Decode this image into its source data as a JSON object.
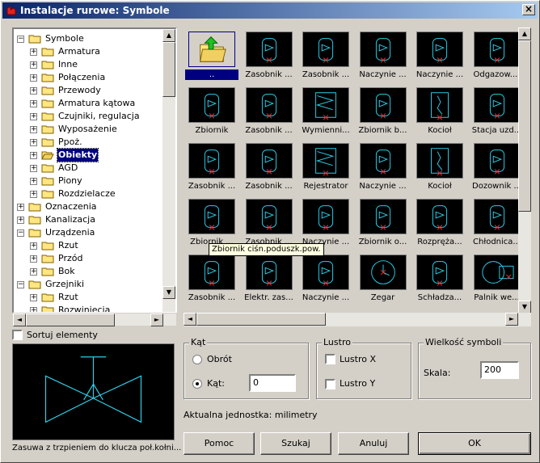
{
  "window": {
    "title": "Instalacje rurowe: Symbole"
  },
  "tree": {
    "items": [
      {
        "label": "Symbole",
        "level": 0,
        "expanded": true
      },
      {
        "label": "Armatura",
        "level": 1
      },
      {
        "label": "Inne",
        "level": 1
      },
      {
        "label": "Połączenia",
        "level": 1
      },
      {
        "label": "Przewody",
        "level": 1
      },
      {
        "label": "Armatura kątowa",
        "level": 1
      },
      {
        "label": "Czujniki, regulacja",
        "level": 1
      },
      {
        "label": "Wyposażenie",
        "level": 1
      },
      {
        "label": "Ppoż.",
        "level": 1
      },
      {
        "label": "Obiekty",
        "level": 1,
        "selected": true
      },
      {
        "label": "AGD",
        "level": 1
      },
      {
        "label": "Piony",
        "level": 1
      },
      {
        "label": "Rozdzielacze",
        "level": 1
      },
      {
        "label": "Oznaczenia",
        "level": 0
      },
      {
        "label": "Kanalizacja",
        "level": 0
      },
      {
        "label": "Urządzenia",
        "level": 0,
        "expanded": true
      },
      {
        "label": "Rzut",
        "level": 1
      },
      {
        "label": "Przód",
        "level": 1
      },
      {
        "label": "Bok",
        "level": 1
      },
      {
        "label": "Grzejniki",
        "level": 0,
        "expanded": true
      },
      {
        "label": "Rzut",
        "level": 1
      },
      {
        "label": "Rozwinięcia",
        "level": 1
      }
    ]
  },
  "symbols": [
    {
      "label": "..",
      "icon": "folder-up-icon"
    },
    {
      "label": "Zasobnik ...",
      "icon": "tank-icon"
    },
    {
      "label": "Zasobnik ...",
      "icon": "tank-icon"
    },
    {
      "label": "Naczynie ...",
      "icon": "tank-icon"
    },
    {
      "label": "Naczynie ...",
      "icon": "tank-icon"
    },
    {
      "label": "Odgazow....",
      "icon": "tank-icon"
    },
    {
      "label": "Zbiornik",
      "icon": "tank-icon"
    },
    {
      "label": "Zasobnik ...",
      "icon": "tank-icon"
    },
    {
      "label": "Wymienni...",
      "icon": "heat-exchanger-icon"
    },
    {
      "label": "Zbiornik b...",
      "icon": "tank-icon"
    },
    {
      "label": "Kocioł",
      "icon": "boiler-icon"
    },
    {
      "label": "Stacja uzd...",
      "icon": "tank-icon"
    },
    {
      "label": "Zasobnik ...",
      "icon": "tank-icon"
    },
    {
      "label": "Zasobnik ...",
      "icon": "tank-icon"
    },
    {
      "label": "Rejestrator",
      "icon": "heat-exchanger-icon"
    },
    {
      "label": "Naczynie ...",
      "icon": "tank-icon"
    },
    {
      "label": "Kocioł",
      "icon": "boiler-icon"
    },
    {
      "label": "Dozownik ...",
      "icon": "tank-icon"
    },
    {
      "label": "Zbiornik ...",
      "icon": "tank-icon"
    },
    {
      "label": "Zasobnik ...",
      "icon": "tank-icon"
    },
    {
      "label": "Naczynie ...",
      "icon": "tank-icon"
    },
    {
      "label": "Zbiornik o...",
      "icon": "tank-icon"
    },
    {
      "label": "Rozpręża...",
      "icon": "tank-icon"
    },
    {
      "label": "Chłodnica...",
      "icon": "tank-icon"
    },
    {
      "label": "Zasobnik ...",
      "icon": "tank-icon"
    },
    {
      "label": "Elektr. zas...",
      "icon": "tank-icon"
    },
    {
      "label": "Naczynie ...",
      "icon": "tank-icon"
    },
    {
      "label": "Zegar",
      "icon": "clock-icon"
    },
    {
      "label": "Schładza...",
      "icon": "tank-icon"
    },
    {
      "label": "Palnik we...",
      "icon": "burner-icon"
    }
  ],
  "tooltip": "Zbiornik ciśn.poduszk.pow.",
  "sort": {
    "label": "Sortuj elementy",
    "checked": false
  },
  "preview": {
    "caption": "Zasuwa z trzpieniem do klucza poł.kołni..."
  },
  "angle": {
    "legend": "Kąt",
    "rotate_label": "Obrót",
    "angle_label": "Kąt:",
    "value": "0"
  },
  "mirror": {
    "legend": "Lustro",
    "x_label": "Lustro X",
    "y_label": "Lustro Y"
  },
  "size": {
    "legend": "Wielkość symboli",
    "scale_label": "Skala:",
    "value": "200"
  },
  "unit_text": "Aktualna jednostka: milimetry",
  "buttons": {
    "help": "Pomoc",
    "search": "Szukaj",
    "cancel": "Anuluj",
    "ok": "OK"
  },
  "colors": {
    "symbol_line": "#2ad0e8",
    "symbol_marker": "#e03030",
    "title_bg": "#0a246a",
    "selection": "#000080"
  }
}
